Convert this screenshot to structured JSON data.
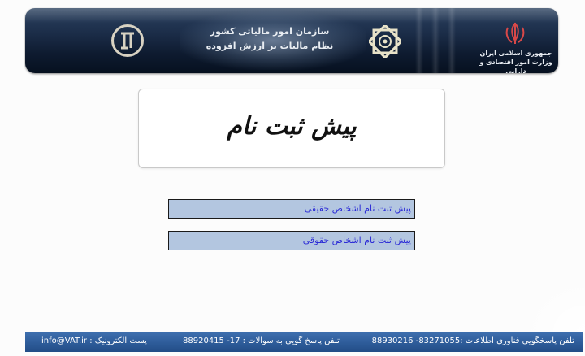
{
  "header": {
    "org_title_line1": "سازمان امور مالیاتی کشور",
    "org_title_line2": "نظام مالیات بر ارزش افزوده",
    "ministry_line1": "جمهوری اسلامی ایران",
    "ministry_line2": "وزارت امور اقتصادی و دارایی",
    "left_logo_icon": "vat-logo-icon",
    "middle_emblem_icon": "tax-organization-emblem-icon",
    "ministry_emblem_icon": "iran-emblem-icon"
  },
  "title": {
    "text": "پیش ثبت نام"
  },
  "links": {
    "natural_persons": "پیش ثبت نام اشخاص حقیقی",
    "legal_persons": "پیش ثبت نام اشخاص حقوقی"
  },
  "footer": {
    "it_support": "تلفن پاسخگویی فناوری اطلاعات :83271055- 88930216",
    "questions_phone": "تلفن پاسخ گویی به سوالات : 17- 88920415",
    "email": "پست الکترونیک : info@VAT.ir"
  },
  "colors": {
    "banner_dark": "#0e1b30",
    "link_bg": "#b3c6e0",
    "link_text": "#2b2bd6",
    "footer_blue": "#2f5d9b"
  }
}
